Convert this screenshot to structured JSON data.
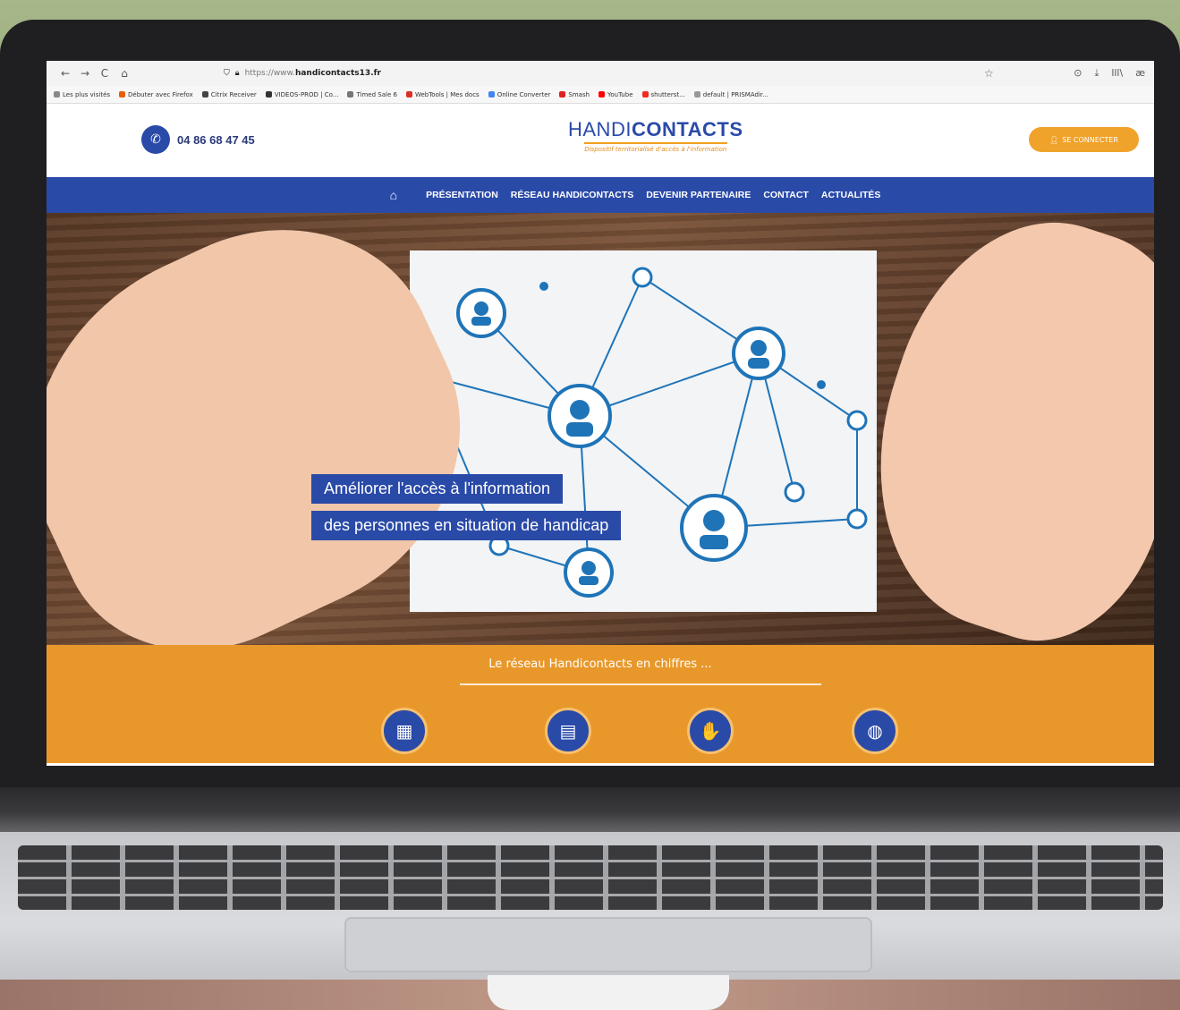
{
  "browser": {
    "url_scheme": "https://www.",
    "url_domain": "handicontacts13.fr",
    "nav": {
      "back": "←",
      "forward": "→",
      "reload": "C",
      "home": "⌂"
    },
    "right_icons": [
      "☆",
      "⊙",
      "⤓",
      "lll\\",
      "æ"
    ],
    "bookmarks": [
      {
        "label": "Les plus visités",
        "color": "#888888"
      },
      {
        "label": "Débuter avec Firefox",
        "color": "#e66000"
      },
      {
        "label": "Citrix Receiver",
        "color": "#444444"
      },
      {
        "label": "VIDEOS-PROD | Co...",
        "color": "#333333"
      },
      {
        "label": "Timed Sale 6",
        "color": "#777777"
      },
      {
        "label": "WebTools | Mes docs",
        "color": "#d93025"
      },
      {
        "label": "Online Converter",
        "color": "#4285f4"
      },
      {
        "label": "Smash",
        "color": "#e02020"
      },
      {
        "label": "YouTube",
        "color": "#ff0000"
      },
      {
        "label": "shutterst...",
        "color": "#ee2b24"
      },
      {
        "label": "default | PRISMAdir...",
        "color": "#999999"
      }
    ]
  },
  "site": {
    "phone": "04 86 68 47 45",
    "logo_part1": "HANDI",
    "logo_part2": "CONTACTS",
    "logo_tagline": "Dispositif territorialisé d'accès à l'information",
    "connect_label": "SE CONNECTER",
    "nav_items": [
      "PRÉSENTATION",
      "RÉSEAU HANDICONTACTS",
      "DEVENIR PARTENAIRE",
      "CONTACT",
      "ACTUALITÉS"
    ],
    "hero_lines": [
      "Améliorer l'accès à l'information",
      "des personnes en situation de handicap"
    ],
    "stats_title": "Le réseau Handicontacts en chiffres ...",
    "stat_icons": [
      {
        "name": "building-icon",
        "glyph": "▦"
      },
      {
        "name": "office-icon",
        "glyph": "▤"
      },
      {
        "name": "handshake-icon",
        "glyph": "✋"
      },
      {
        "name": "globe-icon",
        "glyph": "◍"
      }
    ]
  },
  "colors": {
    "brand_blue": "#2a4aa8",
    "brand_orange": "#e8982a"
  }
}
